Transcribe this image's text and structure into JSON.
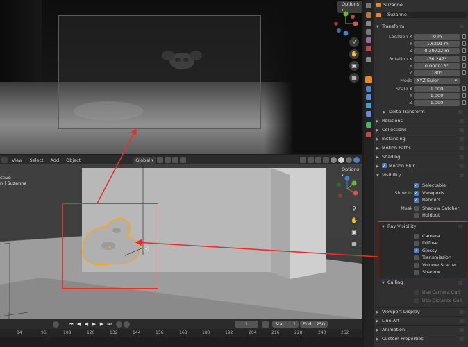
{
  "render_view": {
    "options_label": "Options"
  },
  "viewport": {
    "header": {
      "view": "View",
      "select": "Select",
      "add": "Add",
      "object": "Object",
      "orientation": "Global"
    },
    "options_label": "Options",
    "info_line1": "ctive",
    "info_line2": "n | Suzanne"
  },
  "timeline": {
    "current_frame": "1",
    "start_label": "Start",
    "start_value": "1",
    "end_label": "End",
    "end_value": "250",
    "ticks": [
      "84",
      "96",
      "108",
      "120",
      "132",
      "144",
      "156",
      "168",
      "180",
      "192",
      "204",
      "216",
      "228",
      "240",
      "252"
    ]
  },
  "properties": {
    "top_object_name": "Suzanne",
    "data_name": "Suzanne",
    "transform": {
      "title": "Transform",
      "location_label": "Location X",
      "location": [
        "-0 m",
        "-1.6291 m",
        "0.39722 m"
      ],
      "rotation_label": "Rotation X",
      "rotation": [
        "-36.247°",
        "0.000013°",
        "180°"
      ],
      "mode_label": "Mode",
      "mode_value": "XYZ Euler",
      "scale_label": "Scale X",
      "scale": [
        "1.000",
        "1.000",
        "1.000"
      ],
      "axis_y": "Y",
      "axis_z": "Z",
      "delta": "Delta Transform"
    },
    "sections": {
      "relations": "Relations",
      "collections": "Collections",
      "instancing": "Instancing",
      "motion_paths": "Motion Paths",
      "shading": "Shading",
      "motion_blur": "Motion Blur",
      "visibility": "Visibility",
      "culling": "Culling",
      "viewport_display": "Viewport Display",
      "line_art": "Line Art",
      "animation": "Animation",
      "custom_properties": "Custom Properties"
    },
    "visibility": {
      "selectable": "Selectable",
      "show_in_label": "Show In",
      "viewports": "Viewports",
      "renders": "Renders",
      "mask_label": "Mask",
      "shadow_catcher": "Shadow Catcher",
      "holdout": "Holdout"
    },
    "ray_visibility": {
      "title": "Ray Visibility",
      "items": [
        {
          "label": "Camera",
          "checked": false
        },
        {
          "label": "Diffuse",
          "checked": false
        },
        {
          "label": "Glossy",
          "checked": true
        },
        {
          "label": "Transmission",
          "checked": false
        },
        {
          "label": "Volume Scatter",
          "checked": false
        },
        {
          "label": "Shadow",
          "checked": false
        }
      ]
    },
    "culling": {
      "camera_cull": "Use Camera Cull",
      "distance_cull": "Use Distance Cull"
    }
  },
  "colors": {
    "highlight": "#e53030",
    "accent": "#4a7ac2",
    "selection": "#f5a623"
  }
}
